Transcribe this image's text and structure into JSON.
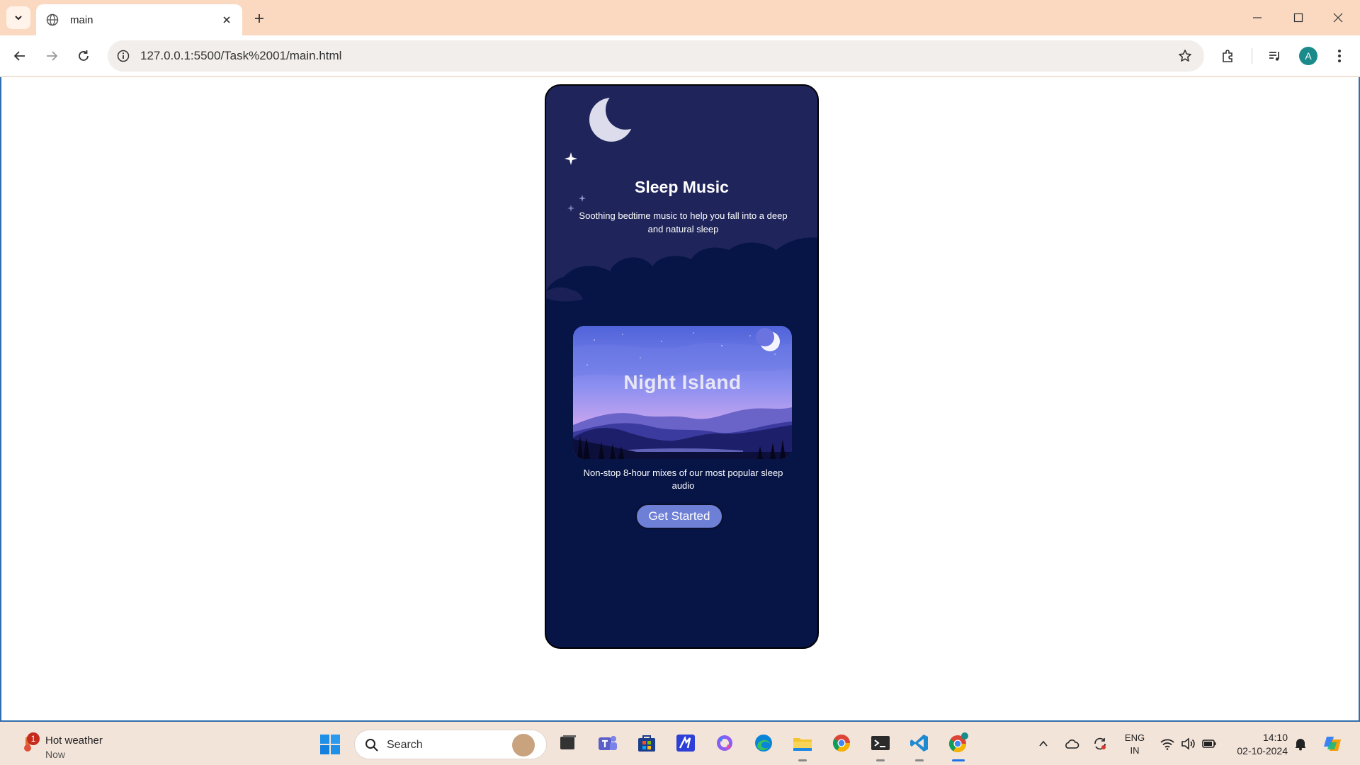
{
  "browser": {
    "tab_title": "main",
    "url": "127.0.0.1:5500/Task%2001/main.html",
    "profile_initial": "A"
  },
  "app": {
    "title": "Sleep Music",
    "subtitle": "Soothing bedtime music to help you fall into a deep and natural sleep",
    "card_title": "Night Island",
    "card_description": "Non-stop 8-hour mixes of our most popular sleep audio",
    "cta_label": "Get Started",
    "colors": {
      "background": "#061446",
      "button": "#6e7fd6"
    }
  },
  "taskbar": {
    "weather_title": "Hot weather",
    "weather_subtitle": "Now",
    "weather_badge": "1",
    "search_placeholder": "Search",
    "lang_line1": "ENG",
    "lang_line2": "IN",
    "time": "14:10",
    "date": "02-10-2024"
  }
}
